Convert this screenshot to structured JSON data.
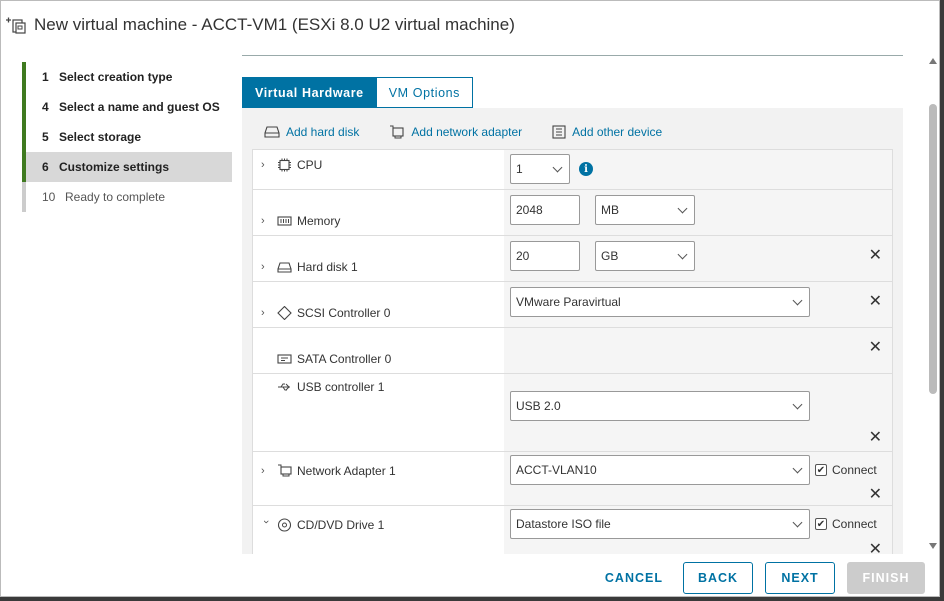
{
  "window": {
    "title": "New virtual machine - ACCT-VM1 (ESXi 8.0 U2 virtual machine)"
  },
  "steps": [
    {
      "num": "1",
      "label": "Select creation type",
      "state": "done"
    },
    {
      "num": "4",
      "label": "Select a name and guest OS",
      "state": "done"
    },
    {
      "num": "5",
      "label": "Select storage",
      "state": "done"
    },
    {
      "num": "6",
      "label": "Customize settings",
      "state": "active"
    },
    {
      "num": "10",
      "label": "Ready to complete",
      "state": "pending"
    }
  ],
  "tabs": {
    "hardware": "Virtual Hardware",
    "options": "VM Options"
  },
  "toolbar": {
    "add_disk": "Add hard disk",
    "add_nic": "Add network adapter",
    "add_other": "Add other device"
  },
  "hardware": {
    "cpu": {
      "label": "CPU",
      "value": "1"
    },
    "memory": {
      "label": "Memory",
      "value": "2048",
      "unit": "MB"
    },
    "disk": {
      "label": "Hard disk 1",
      "value": "20",
      "unit": "GB"
    },
    "scsi": {
      "label": "SCSI Controller 0",
      "value": "VMware Paravirtual"
    },
    "sata": {
      "label": "SATA Controller 0"
    },
    "usb": {
      "label": "USB controller 1",
      "value": "USB 2.0"
    },
    "nic": {
      "label": "Network Adapter 1",
      "value": "ACCT-VLAN10",
      "connect": "Connect"
    },
    "cd": {
      "label": "CD/DVD Drive 1",
      "value": "Datastore ISO file",
      "connect": "Connect"
    }
  },
  "footer": {
    "cancel": "CANCEL",
    "back": "BACK",
    "next": "NEXT",
    "finish": "FINISH"
  },
  "colors": {
    "accent": "#0072a3",
    "done_step": "#3f7a1f"
  }
}
